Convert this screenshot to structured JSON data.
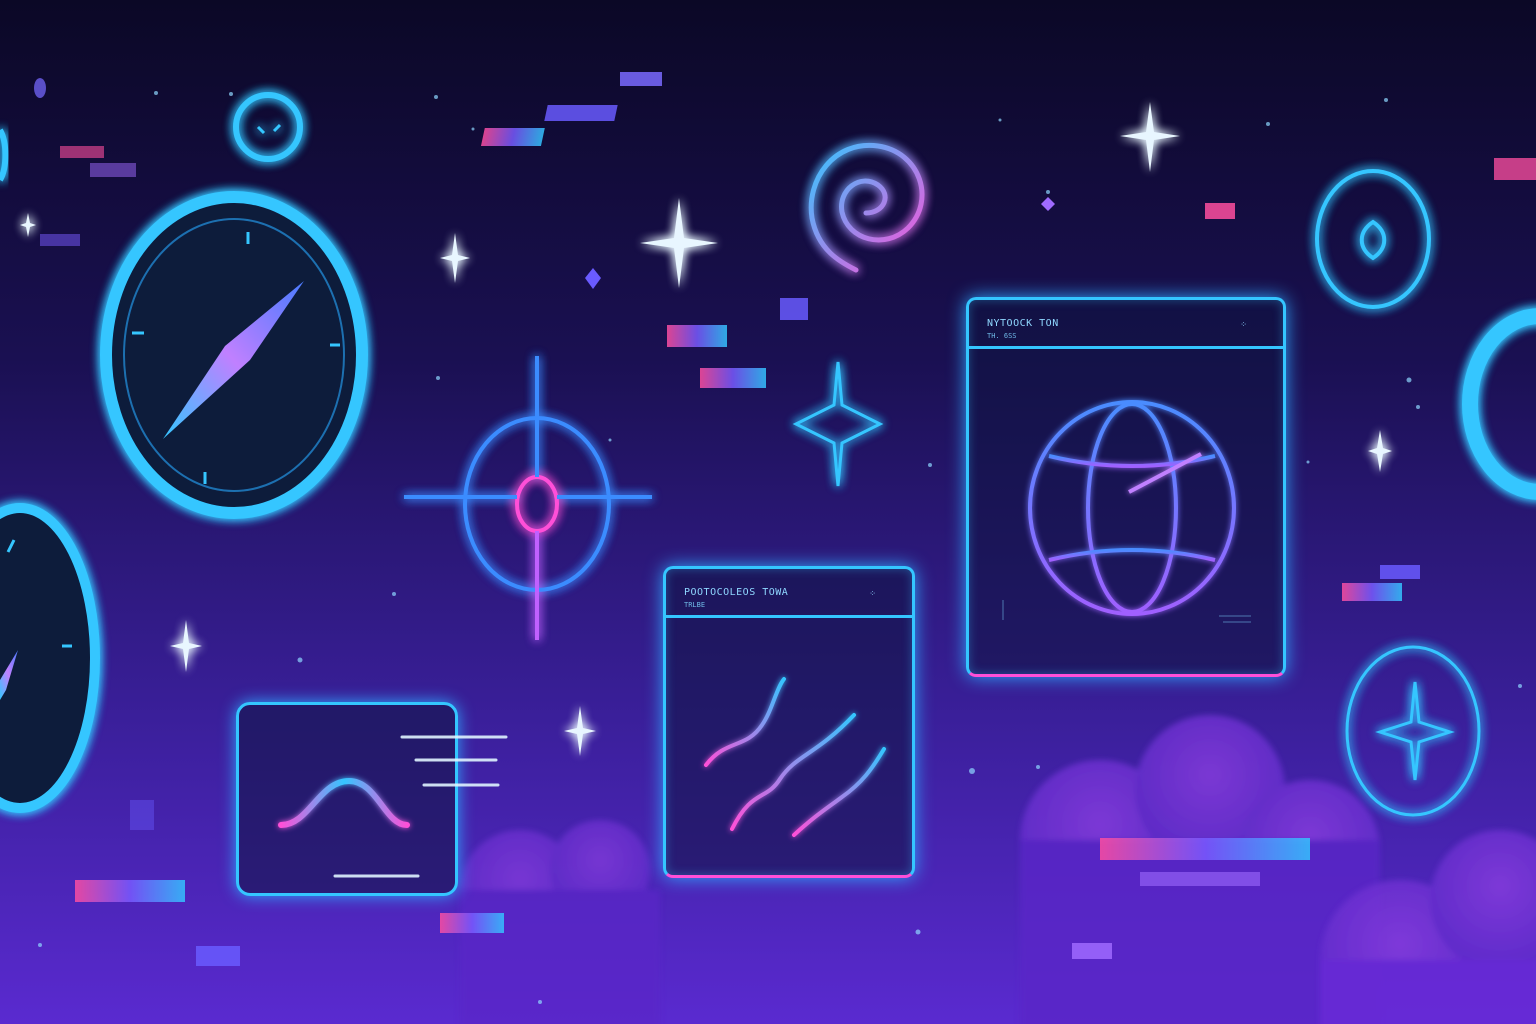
{
  "colors": {
    "background_top": "#0b0826",
    "background_bottom": "#5a2ad0",
    "neon_cyan": "#34c6ff",
    "neon_pink": "#ff4fd8",
    "neon_violet": "#a26bff"
  },
  "icons": [
    "compass-icon",
    "spiral-icon",
    "sparkle-icon",
    "target-crosshair-icon",
    "globe-icon",
    "line-graph-icon",
    "wave-graph-icon",
    "ring-icon"
  ],
  "panels": {
    "globe": {
      "title": "NYTOOCK TON",
      "subtitle": "TH. 6SS"
    },
    "graph": {
      "title": "POOTOCOLEOS TOWA",
      "subtitle": "TRLBE"
    }
  }
}
